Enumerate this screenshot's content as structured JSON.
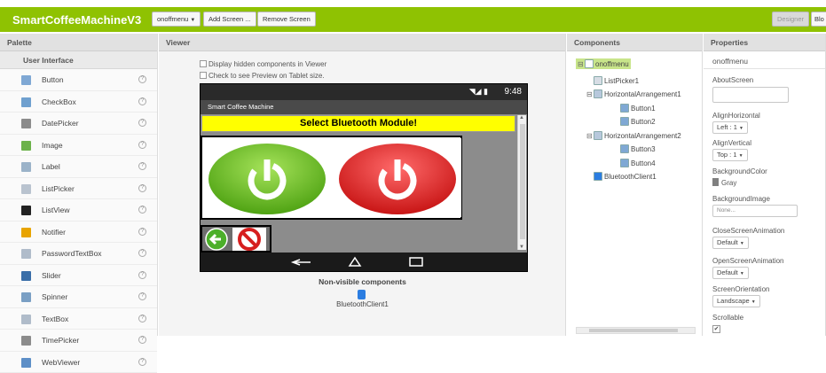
{
  "app": {
    "title": "SmartCoffeeMachineV3",
    "screen_select_label": "onoffmenu",
    "add_screen_label": "Add Screen ...",
    "remove_screen_label": "Remove Screen",
    "designer_label": "Designer",
    "blocks_label": "Blo"
  },
  "palette": {
    "title": "Palette",
    "category": "User Interface",
    "help_glyph": "?",
    "items": [
      {
        "label": "Button",
        "icon": "button-icon",
        "color": "#7fa8d4"
      },
      {
        "label": "CheckBox",
        "icon": "checkbox-icon",
        "color": "#6fa0cf"
      },
      {
        "label": "DatePicker",
        "icon": "datepicker-icon",
        "color": "#8c8c8c"
      },
      {
        "label": "Image",
        "icon": "image-icon",
        "color": "#6cb24a"
      },
      {
        "label": "Label",
        "icon": "label-icon",
        "color": "#9bb3c9"
      },
      {
        "label": "ListPicker",
        "icon": "listpicker-icon",
        "color": "#b9c3cf"
      },
      {
        "label": "ListView",
        "icon": "listview-icon",
        "color": "#222222"
      },
      {
        "label": "Notifier",
        "icon": "notifier-icon",
        "color": "#e8a400"
      },
      {
        "label": "PasswordTextBox",
        "icon": "password-icon",
        "color": "#b0bcca"
      },
      {
        "label": "Slider",
        "icon": "slider-icon",
        "color": "#3a6ea8"
      },
      {
        "label": "Spinner",
        "icon": "spinner-icon",
        "color": "#7a9fc4"
      },
      {
        "label": "TextBox",
        "icon": "textbox-icon",
        "color": "#b0bcca"
      },
      {
        "label": "TimePicker",
        "icon": "timepicker-icon",
        "color": "#8c8c8c"
      },
      {
        "label": "WebViewer",
        "icon": "webviewer-icon",
        "color": "#5d8fc7"
      }
    ]
  },
  "viewer": {
    "title": "Viewer",
    "display_hidden_label": "Display hidden components in Viewer",
    "tablet_label": "Check to see Preview on Tablet size.",
    "status_time": "9:48",
    "screen_title": "Smart Coffee Machine",
    "select_bt_label": "Select Bluetooth Module!",
    "nonvisible_title": "Non-visible components",
    "nonvisible_item": "BluetoothClient1"
  },
  "components": {
    "title": "Components",
    "tree": [
      {
        "label": "onoffmenu",
        "indent": 0,
        "toggle": "⊟",
        "icon": "screen-icon",
        "selected": true
      },
      {
        "label": "ListPicker1",
        "indent": 1,
        "toggle": "",
        "icon": "listpicker-icon"
      },
      {
        "label": "HorizontalArrangement1",
        "indent": 1,
        "toggle": "⊟",
        "icon": "arrangement-icon"
      },
      {
        "label": "Button1",
        "indent": 2,
        "toggle": "",
        "icon": "button-icon"
      },
      {
        "label": "Button2",
        "indent": 2,
        "toggle": "",
        "icon": "button-icon"
      },
      {
        "label": "HorizontalArrangement2",
        "indent": 1,
        "toggle": "⊟",
        "icon": "arrangement-icon"
      },
      {
        "label": "Button3",
        "indent": 2,
        "toggle": "",
        "icon": "button-icon"
      },
      {
        "label": "Button4",
        "indent": 2,
        "toggle": "",
        "icon": "button-icon"
      },
      {
        "label": "BluetoothClient1",
        "indent": 1,
        "toggle": "",
        "icon": "bluetooth-icon"
      }
    ]
  },
  "properties": {
    "title": "Properties",
    "selected_component": "onoffmenu",
    "about_screen_label": "AboutScreen",
    "align_horizontal_label": "AlignHorizontal",
    "align_horizontal_value": "Left : 1",
    "align_vertical_label": "AlignVertical",
    "align_vertical_value": "Top : 1",
    "bg_color_label": "BackgroundColor",
    "bg_color_value": "Gray",
    "bg_color_hex": "#808080",
    "bg_image_label": "BackgroundImage",
    "bg_image_value": "None...",
    "close_anim_label": "CloseScreenAnimation",
    "close_anim_value": "Default",
    "open_anim_label": "OpenScreenAnimation",
    "open_anim_value": "Default",
    "orientation_label": "ScreenOrientation",
    "orientation_value": "Landscape",
    "scrollable_label": "Scrollable",
    "scrollable_checked": true
  },
  "colors": {
    "accent_green": "#8fc202",
    "select_bg": "#ffff00",
    "power_on": "#6cc326",
    "power_off": "#e02a2a"
  }
}
